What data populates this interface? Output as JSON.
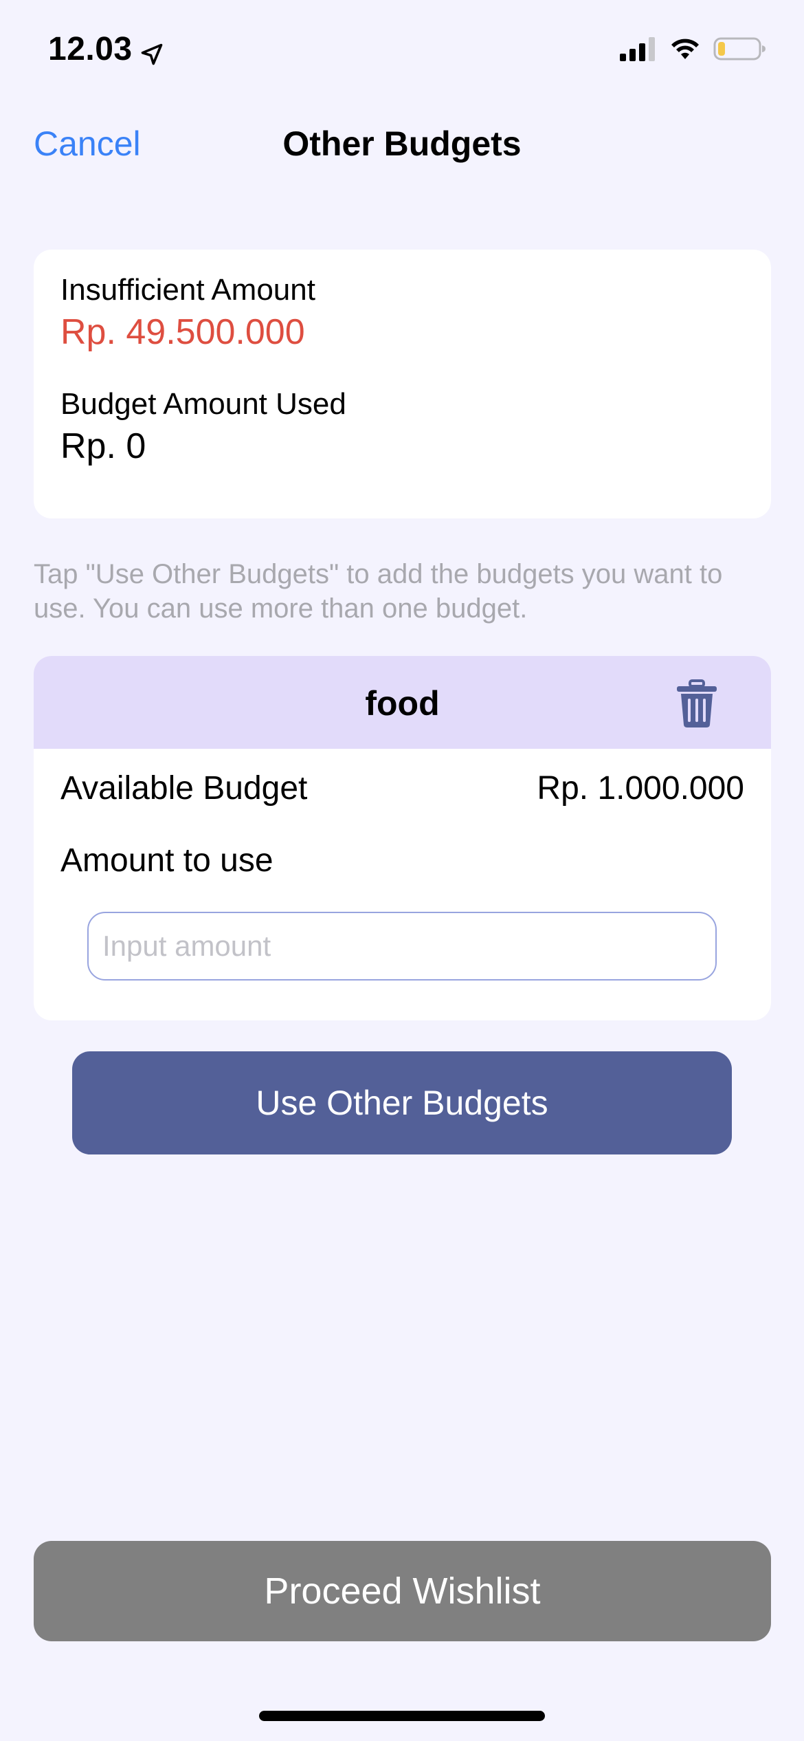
{
  "status_bar": {
    "time": "12.03",
    "location_icon": "location-arrow-icon",
    "signal_icon": "cellular-signal-icon",
    "wifi_icon": "wifi-icon",
    "battery_icon": "battery-low-icon",
    "battery_level": 0.15,
    "battery_color": "#F5C84A"
  },
  "nav": {
    "cancel_label": "Cancel",
    "title": "Other Budgets",
    "accent_color": "#3A82F7"
  },
  "summary": {
    "insufficient_label": "Insufficient Amount",
    "insufficient_value": "Rp. 49.500.000",
    "insufficient_color": "#DE4E40",
    "used_label": "Budget Amount Used",
    "used_value": "Rp. 0"
  },
  "hint": "Tap \"Use Other Budgets\" to add the budgets you want to use. You can use more than one budget.",
  "budget_card": {
    "name": "food",
    "delete_icon": "trash-icon",
    "available_label": "Available Budget",
    "available_value": "Rp. 1.000.000",
    "amount_label": "Amount to use",
    "amount_value": "",
    "amount_placeholder": "Input amount",
    "header_color": "#E2DBFA"
  },
  "buttons": {
    "use_other_budgets": "Use Other Budgets",
    "use_other_budgets_color": "#536098",
    "proceed": "Proceed Wishlist",
    "proceed_color": "#808080"
  }
}
